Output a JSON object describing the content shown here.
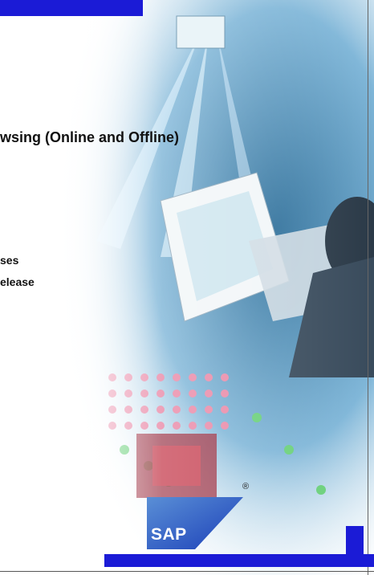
{
  "title": "wsing (Online and Offline)",
  "subtitle_lines": [
    "ses",
    "elease"
  ],
  "logo": {
    "text": "SAP",
    "registered_mark": "®"
  },
  "colors": {
    "accent_blue": "#1b1bd6",
    "collage_base": "#6aa0c8"
  }
}
